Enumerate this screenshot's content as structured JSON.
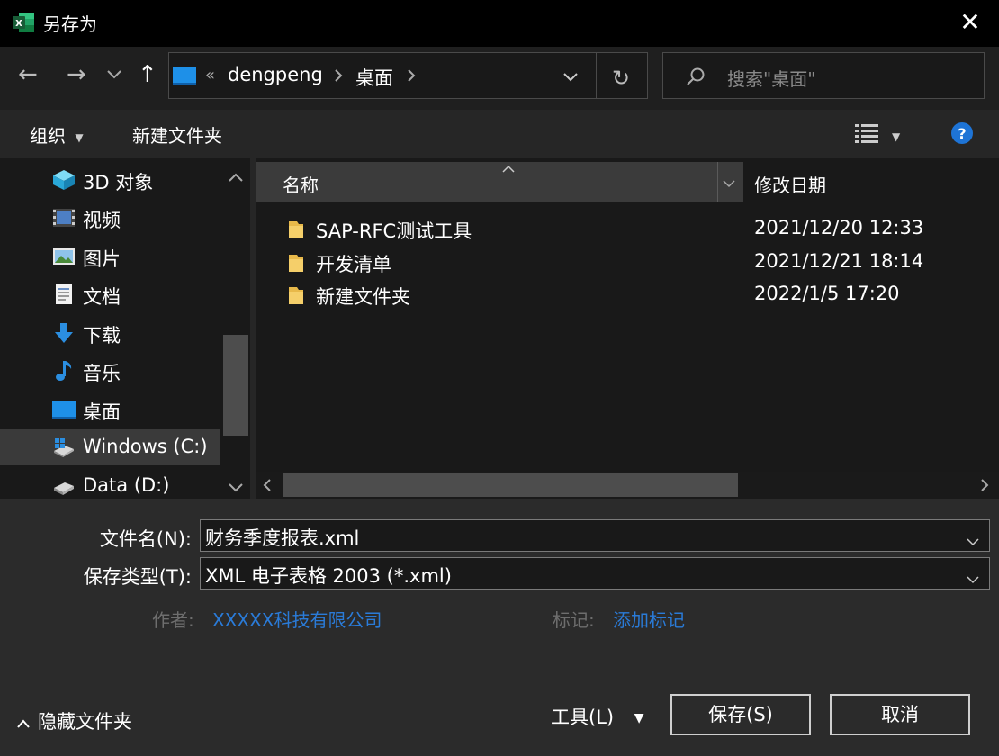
{
  "window": {
    "title": "另存为",
    "app_icon": "excel-icon"
  },
  "nav": {
    "back_icon": "back-arrow-icon",
    "forward_icon": "forward-arrow-icon",
    "recent_icon": "chevron-down-icon",
    "up_icon": "up-arrow-icon",
    "path_prefix": "«",
    "path": [
      "dengpeng",
      "桌面"
    ],
    "search_placeholder": "搜索\"桌面\""
  },
  "commands": {
    "organize": "组织",
    "new_folder": "新建文件夹"
  },
  "sidebar": {
    "items": [
      {
        "label": "3D 对象",
        "icon": "3d-objects-icon"
      },
      {
        "label": "视频",
        "icon": "video-icon"
      },
      {
        "label": "图片",
        "icon": "pictures-icon"
      },
      {
        "label": "文档",
        "icon": "documents-icon"
      },
      {
        "label": "下载",
        "icon": "download-icon"
      },
      {
        "label": "音乐",
        "icon": "music-icon"
      },
      {
        "label": "桌面",
        "icon": "desktop-icon"
      },
      {
        "label": "Windows (C:)",
        "icon": "drive-c-icon"
      },
      {
        "label": "Data (D:)",
        "icon": "drive-d-icon"
      }
    ],
    "selected_index": 7
  },
  "files": {
    "columns": {
      "name": "名称",
      "modified": "修改日期"
    },
    "rows": [
      {
        "name": "SAP-RFC测试工具",
        "modified": "2021/12/20 12:33"
      },
      {
        "name": "开发清单",
        "modified": "2021/12/21 18:14"
      },
      {
        "name": "新建文件夹",
        "modified": "2022/1/5 17:20"
      }
    ]
  },
  "form": {
    "filename_label": "文件名(N):",
    "filename_value": "财务季度报表.xml",
    "filetype_label": "保存类型(T):",
    "filetype_value": "XML 电子表格 2003 (*.xml)",
    "author_label": "作者:",
    "author_value": "XXXXX科技有限公司",
    "tags_label": "标记:",
    "tags_value": "添加标记"
  },
  "footer": {
    "hide_folders": "隐藏文件夹",
    "tools": "工具(L)",
    "save": "保存(S)",
    "cancel": "取消"
  },
  "colors": {
    "link": "#2a7bd8",
    "help": "#1e74d6",
    "folder": "#e8b94a"
  }
}
